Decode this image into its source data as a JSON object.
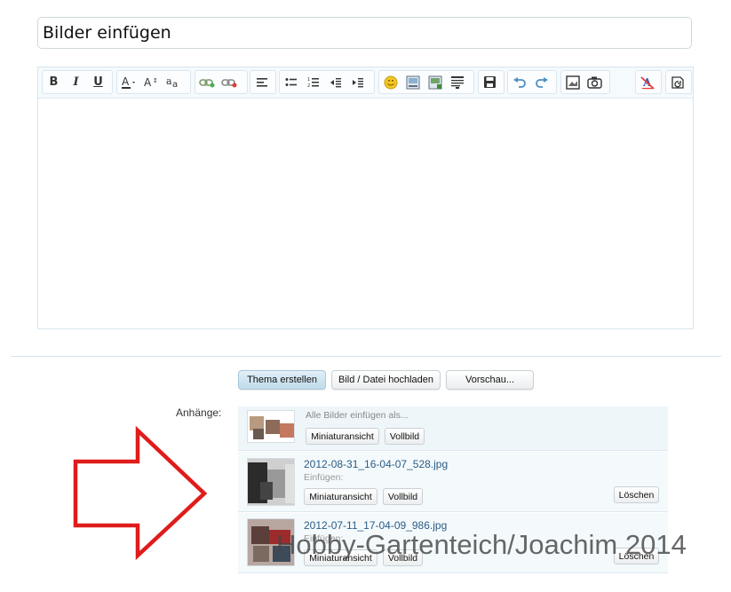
{
  "title_field": {
    "value": "Bilder einfügen"
  },
  "toolbar": {
    "bold": "B",
    "italic": "I",
    "underline": "U",
    "icons": [
      "bold-icon",
      "italic-icon",
      "underline-icon",
      "font-color-icon",
      "font-size-icon",
      "font-family-icon",
      "insert-link-icon",
      "remove-link-icon",
      "align-icon",
      "bullet-list-icon",
      "numbered-list-icon",
      "outdent-icon",
      "indent-icon",
      "smilie-icon",
      "insert-image-icon",
      "insert-media-icon",
      "insert-code-icon",
      "save-draft-icon",
      "undo-icon",
      "redo-icon",
      "preview-image-icon",
      "camera-icon",
      "remove-format-icon",
      "toggle-source-icon"
    ]
  },
  "buttons": {
    "create_thread": "Thema erstellen",
    "upload": "Bild / Datei hochladen",
    "preview": "Vorschau..."
  },
  "attachments": {
    "label": "Anhänge:",
    "insert_all": "Alle Bilder einfügen als...",
    "thumbnail": "Miniaturansicht",
    "full": "Vollbild",
    "insert_label": "Einfügen:",
    "delete": "Löschen",
    "files": [
      {
        "name": "2012-08-31_16-04-07_528.jpg"
      },
      {
        "name": "2012-07-11_17-04-09_986.jpg"
      }
    ]
  },
  "watermark": "Hobby-Gartenteich/Joachim 2014",
  "colors": {
    "arrow": "#e01b1b",
    "link": "#2a5c85",
    "toolbar_bg": "#f5fafd"
  }
}
